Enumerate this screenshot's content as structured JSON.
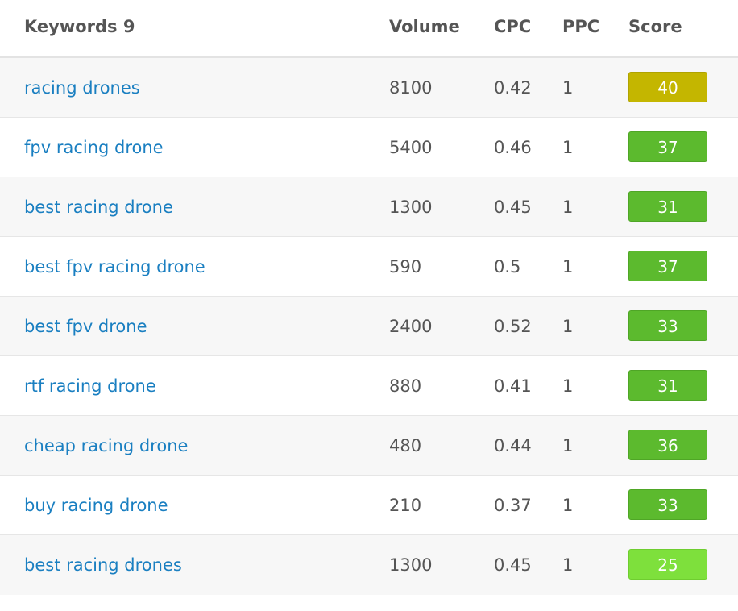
{
  "header": {
    "keywords_label": "Keywords 9",
    "volume_label": "Volume",
    "cpc_label": "CPC",
    "ppc_label": "PPC",
    "score_label": "Score"
  },
  "rows": [
    {
      "keyword": "racing drones",
      "volume": "8100",
      "cpc": "0.42",
      "ppc": "1",
      "score": "40",
      "score_color": "#c4b600",
      "score_border": "#b0a300"
    },
    {
      "keyword": "fpv racing drone",
      "volume": "5400",
      "cpc": "0.46",
      "ppc": "1",
      "score": "37",
      "score_color": "#5cba2e",
      "score_border": "#4fa626"
    },
    {
      "keyword": "best racing drone",
      "volume": "1300",
      "cpc": "0.45",
      "ppc": "1",
      "score": "31",
      "score_color": "#5cba2e",
      "score_border": "#4fa626"
    },
    {
      "keyword": "best fpv racing drone",
      "volume": "590",
      "cpc": "0.5",
      "ppc": "1",
      "score": "37",
      "score_color": "#5cba2e",
      "score_border": "#4fa626"
    },
    {
      "keyword": "best fpv drone",
      "volume": "2400",
      "cpc": "0.52",
      "ppc": "1",
      "score": "33",
      "score_color": "#5cba2e",
      "score_border": "#4fa626"
    },
    {
      "keyword": "rtf racing drone",
      "volume": "880",
      "cpc": "0.41",
      "ppc": "1",
      "score": "31",
      "score_color": "#5cba2e",
      "score_border": "#4fa626"
    },
    {
      "keyword": "cheap racing drone",
      "volume": "480",
      "cpc": "0.44",
      "ppc": "1",
      "score": "36",
      "score_color": "#5cba2e",
      "score_border": "#4fa626"
    },
    {
      "keyword": "buy racing drone",
      "volume": "210",
      "cpc": "0.37",
      "ppc": "1",
      "score": "33",
      "score_color": "#5cba2e",
      "score_border": "#4fa626"
    },
    {
      "keyword": "best racing drones",
      "volume": "1300",
      "cpc": "0.45",
      "ppc": "1",
      "score": "25",
      "score_color": "#7ee03c",
      "score_border": "#6fcd30"
    }
  ]
}
